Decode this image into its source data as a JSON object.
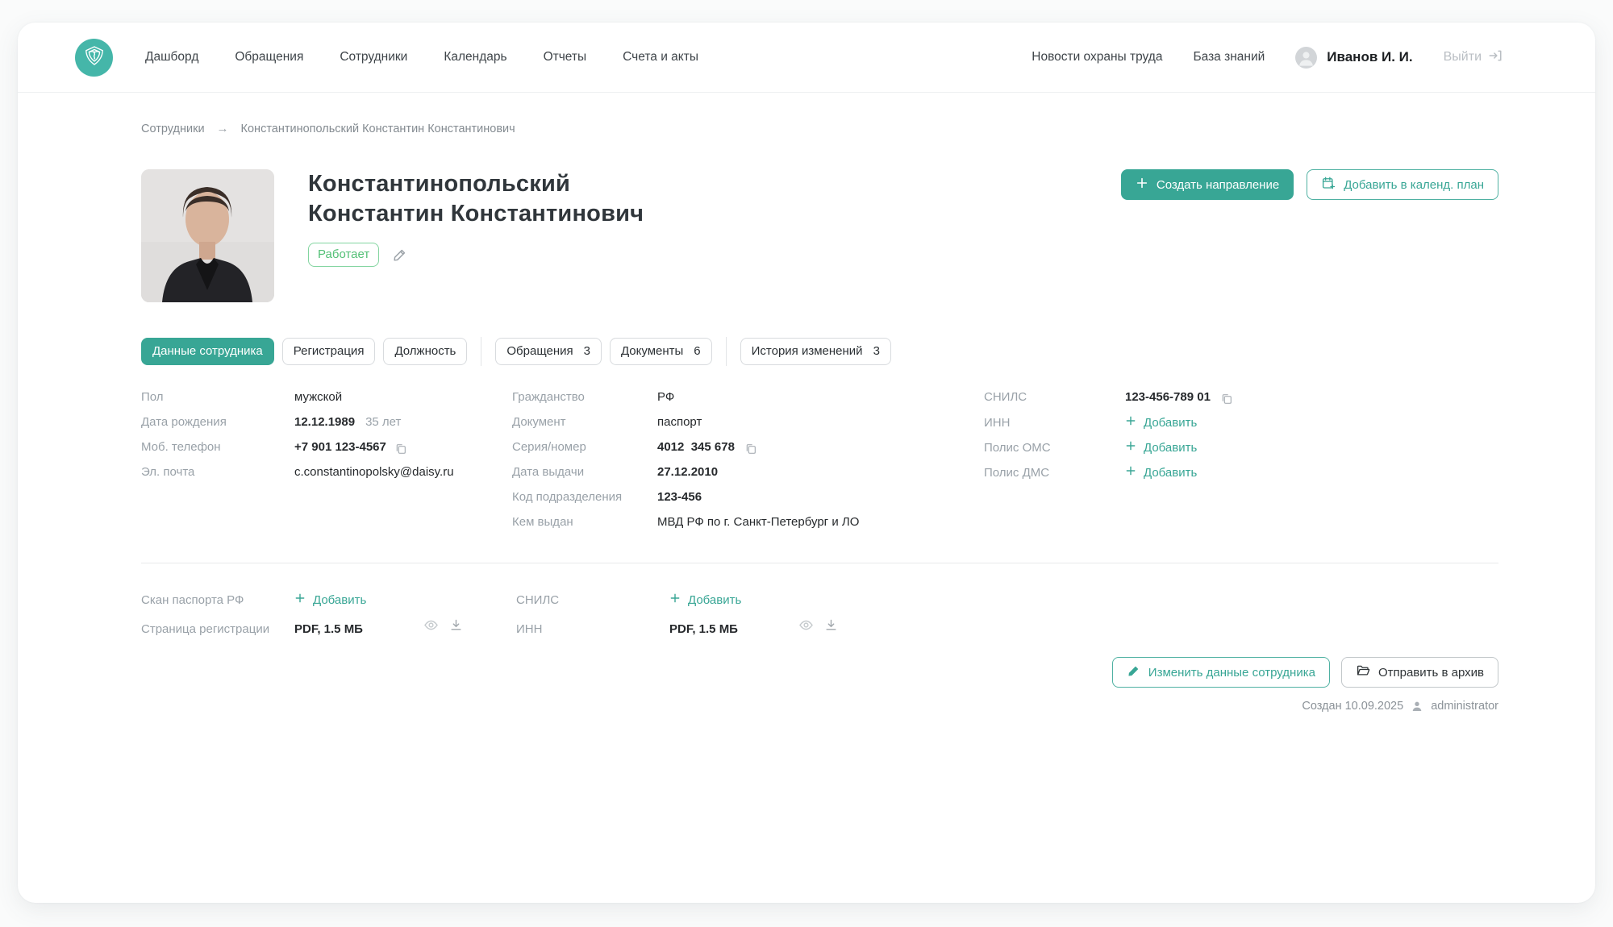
{
  "nav": {
    "items": [
      {
        "label": "Дашборд"
      },
      {
        "label": "Обращения"
      },
      {
        "label": "Сотрудники"
      },
      {
        "label": "Календарь"
      },
      {
        "label": "Отчеты"
      },
      {
        "label": "Счета и акты"
      }
    ],
    "secondary": [
      {
        "label": "Новости охраны труда"
      },
      {
        "label": "База знаний"
      }
    ],
    "user_name": "Иванов И. И.",
    "logout_label": "Выйти"
  },
  "breadcrumb": {
    "root": "Сотрудники",
    "arrow": "→",
    "current": "Константинопольский Константин Константинович"
  },
  "employee": {
    "name_line1": "Константинопольский",
    "name_line2": "Константин Константинович",
    "status": "Работает"
  },
  "actions": {
    "create_referral": "Создать направление",
    "add_calendar": "Добавить в календ. план",
    "edit": "Изменить данные сотрудника",
    "archive": "Отправить в архив"
  },
  "tabs": [
    {
      "label": "Данные сотрудника"
    },
    {
      "label": "Регистрация"
    },
    {
      "label": "Должность"
    },
    {
      "label": "Обращения",
      "count": "3"
    },
    {
      "label": "Документы",
      "count": "6"
    },
    {
      "label": "История изменений",
      "count": "3"
    }
  ],
  "details": {
    "personal": {
      "gender_label": "Пол",
      "gender": "мужской",
      "birth_label": "Дата рождения",
      "birth": "12.12.1989",
      "age": "35 лет",
      "phone_label": "Моб. телефон",
      "phone": "+7 901 123-4567",
      "email_label": "Эл. почта",
      "email": "c.constantinopolsky@daisy.ru"
    },
    "passport": {
      "citizenship_label": "Гражданство",
      "citizenship": "РФ",
      "doc_label": "Документ",
      "doc": "паспорт",
      "series_label": "Серия/номер",
      "series": "4012  345 678",
      "issue_date_label": "Дата выдачи",
      "issue_date": "27.12.2010",
      "division_label": "Код подразделения",
      "division": "123-456",
      "issuer_label": "Кем выдан",
      "issuer": "МВД РФ по г. Санкт-Петербург и ЛО"
    },
    "ids": {
      "snils_label": "СНИЛС",
      "snils": "123-456-789 01",
      "inn_label": "ИНН",
      "oms_label": "Полис ОМС",
      "dms_label": "Полис ДМС",
      "add_label": "Добавить"
    }
  },
  "documents": {
    "passport_scan_label": "Скан паспорта РФ",
    "registration_label": "Страница регистрации",
    "registration_file": "PDF, 1.5 МБ",
    "snils_label": "СНИЛС",
    "inn_label": "ИНН",
    "inn_file": "PDF, 1.5 МБ",
    "add_label": "Добавить"
  },
  "footer": {
    "created": "Создан 10.09.2025",
    "author": "administrator"
  },
  "colors": {
    "primary_teal": "#38a695",
    "logo_teal": "#45b6a9",
    "status_green": "#53c076"
  }
}
